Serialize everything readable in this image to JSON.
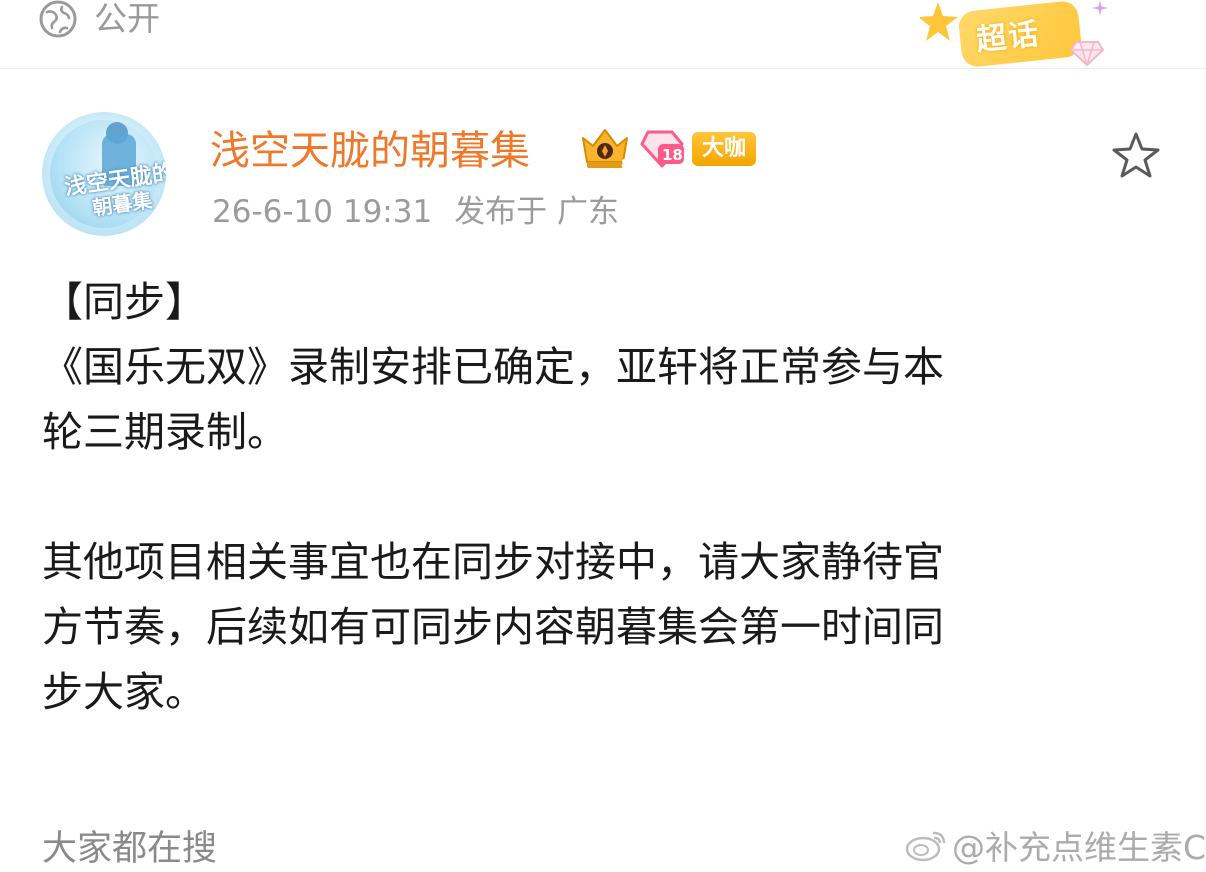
{
  "header": {
    "visibility_icon": "globe-icon",
    "visibility_label": "公开",
    "supertopic_label": "超话"
  },
  "author": {
    "avatar_text_line1": "浅空天胧的",
    "avatar_text_line2": "朝暮集",
    "name": "浅空天胧的朝暮集",
    "rank_number": "18",
    "badge_label": "大咖",
    "follow_icon": "star-icon"
  },
  "meta": {
    "timestamp": "26-6-10 19:31",
    "location": "发布于 广东"
  },
  "post": {
    "lines": [
      "【同步】",
      "《国乐无双》录制安排已确定，亚轩将正常参与本",
      "轮三期录制。",
      "",
      "其他项目相关事宜也在同步对接中，请大家静待官",
      "方节奏，后续如有可同步内容朝暮集会第一时间同",
      "步大家。"
    ]
  },
  "footer": {
    "hot_search_label": "大家都在搜",
    "watermark": "@补充点维生素C"
  },
  "colors": {
    "username": "#f0782a",
    "badge": "#ffb81c",
    "muted": "#9b9b9b"
  }
}
